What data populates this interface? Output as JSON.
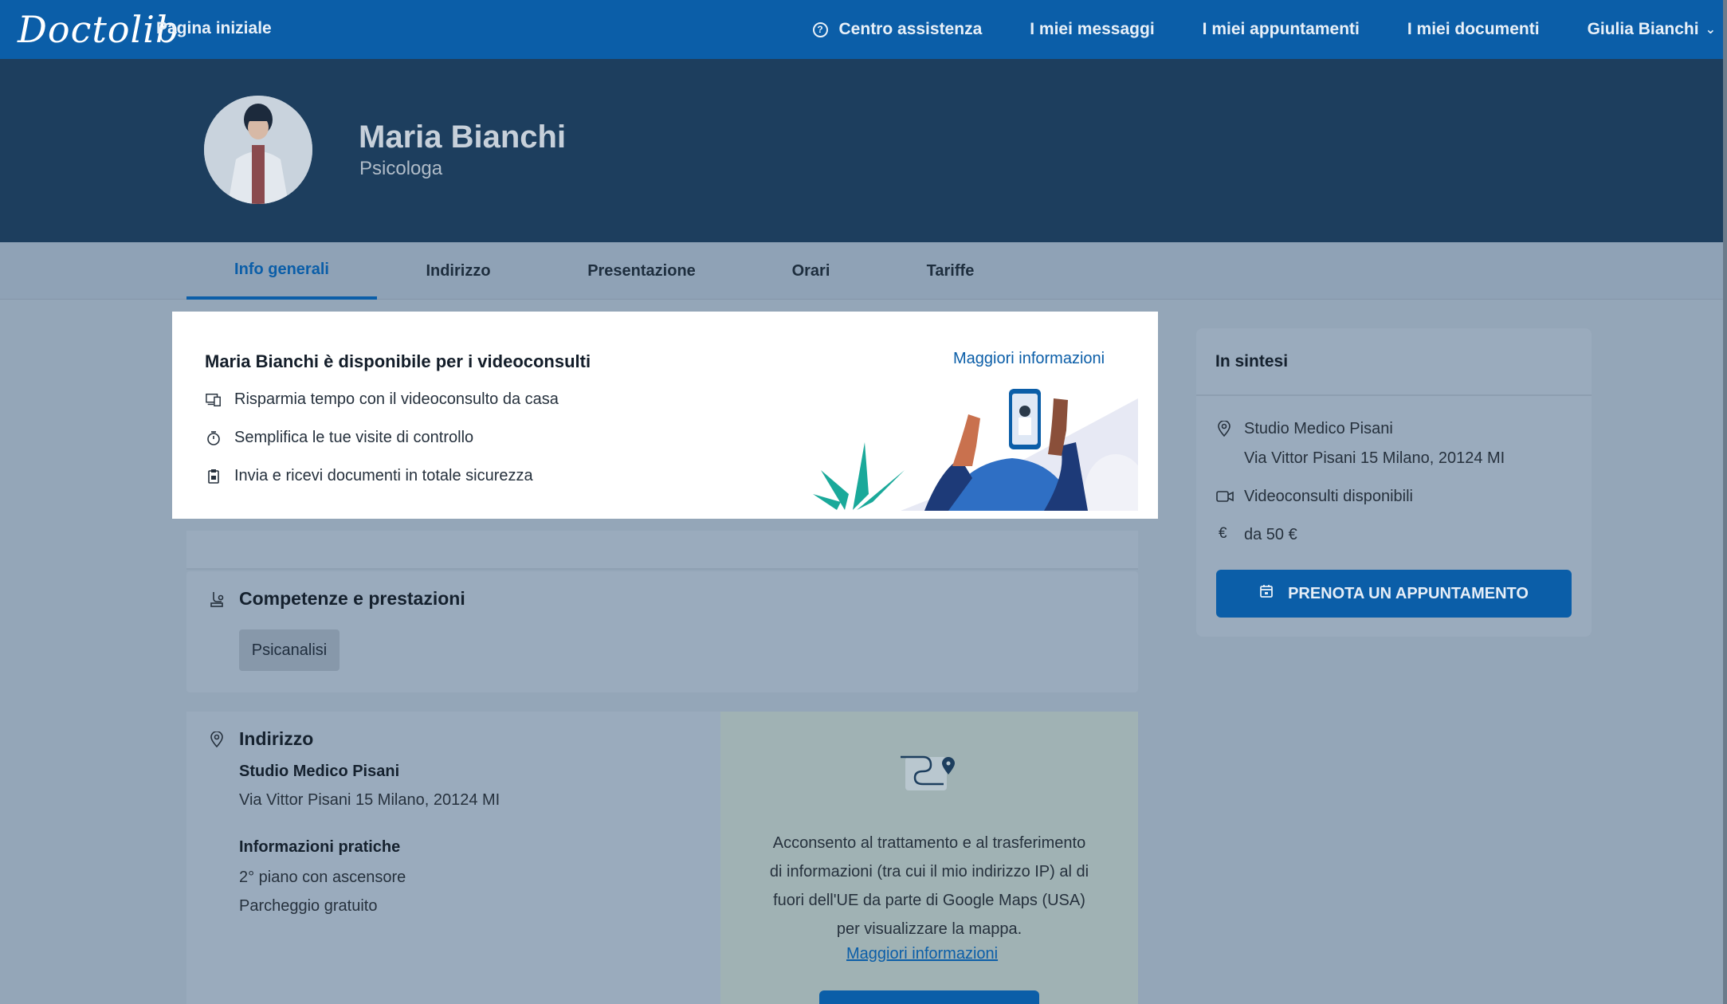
{
  "nav": {
    "logo": "Doctolib",
    "home": "Pagina iniziale",
    "help": "Centro assistenza",
    "messages": "I miei messaggi",
    "appointments": "I miei appuntamenti",
    "documents": "I miei documenti",
    "user": "Giulia Bianchi"
  },
  "profile": {
    "name": "Maria Bianchi",
    "specialty": "Psicologa"
  },
  "tabs": [
    "Info generali",
    "Indirizzo",
    "Presentazione",
    "Orari",
    "Tariffe"
  ],
  "banner": {
    "title": "Maria Bianchi è disponibile per i videoconsulti",
    "more_info": "Maggiori informazioni",
    "benefits": [
      "Risparmia tempo con il videoconsulto da casa",
      "Semplifica le tue visite di controllo",
      "Invia e ricevi documenti in totale sicurezza"
    ]
  },
  "skills": {
    "title": "Competenze e prestazioni",
    "items": [
      "Psicanalisi"
    ]
  },
  "address": {
    "title": "Indirizzo",
    "place": "Studio Medico Pisani",
    "street": "Via Vittor Pisani 15 Milano, 20124 MI",
    "practical_title": "Informazioni pratiche",
    "practical": [
      "2° piano con ascensore",
      "Parcheggio gratuito"
    ]
  },
  "map": {
    "consent_lines": [
      "Acconsento al trattamento e al trasferimento",
      "di informazioni (tra cui il mio indirizzo IP) al di",
      "fuori dell'UE da parte di Google Maps (USA)",
      "per visualizzare la mappa."
    ],
    "more_info": "Maggiori informazioni"
  },
  "summary": {
    "title": "In sintesi",
    "place": "Studio Medico Pisani",
    "street": "Via Vittor Pisani 15 Milano, 20124 MI",
    "video": "Videoconsulti disponibili",
    "price": "da 50 €",
    "book": "PRENOTA UN APPUNTAMENTO"
  },
  "colors": {
    "primary": "#0b5ea8",
    "header": "#1d3e5e",
    "overlay_bg": "#94a6b8"
  }
}
